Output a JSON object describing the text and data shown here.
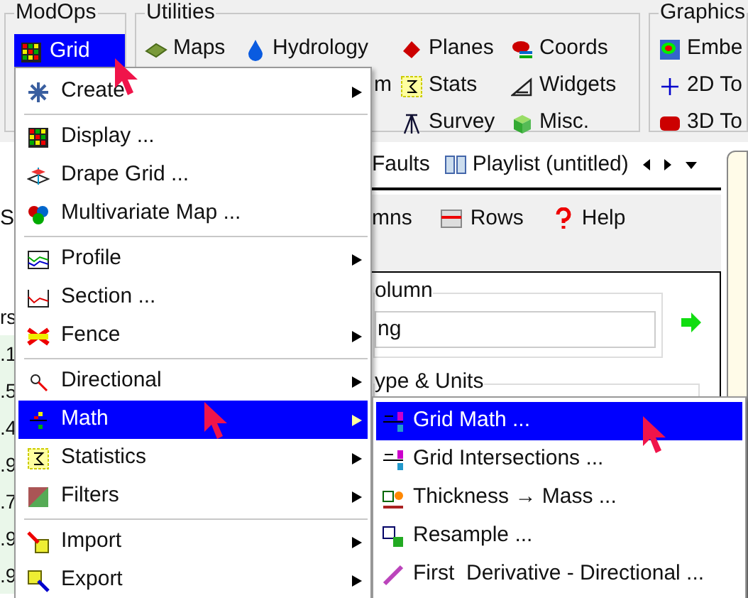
{
  "ribbon": {
    "groups": [
      {
        "title": "ModOps",
        "items": [
          {
            "label": "Grid",
            "selected": true
          }
        ]
      },
      {
        "title": "Utilities",
        "items": [
          {
            "label": "Maps"
          },
          {
            "label": "Hydrology"
          },
          {
            "label": "Planes"
          },
          {
            "label": "Coords"
          },
          {
            "label": "m"
          },
          {
            "label": "Stats"
          },
          {
            "label": "Widgets"
          },
          {
            "label": "Survey"
          },
          {
            "label": "Misc."
          }
        ]
      },
      {
        "title": "Graphics",
        "items": [
          {
            "label": "Embe"
          },
          {
            "label": "2D To"
          },
          {
            "label": "3D To"
          }
        ]
      }
    ]
  },
  "tabs": [
    {
      "label": "Faults"
    },
    {
      "label": "Playlist (untitled)"
    }
  ],
  "toolbar": [
    {
      "label": "S"
    },
    {
      "label": "mns"
    },
    {
      "label": "Rows"
    },
    {
      "label": "Help"
    }
  ],
  "side_values": [
    "rs",
    ".1",
    ".5",
    ".4",
    ".9",
    ".7",
    ".9",
    ".9"
  ],
  "panel": {
    "column_group": "olumn",
    "column_value": "ng",
    "type_group": "ype & Units"
  },
  "menu": [
    {
      "kind": "item",
      "label": "Create",
      "submenu": true,
      "selected": false
    },
    {
      "kind": "separator"
    },
    {
      "kind": "item",
      "label": "Display ...",
      "submenu": false,
      "selected": false
    },
    {
      "kind": "item",
      "label": "Drape Grid ...",
      "submenu": false,
      "selected": false
    },
    {
      "kind": "item",
      "label": "Multivariate Map ...",
      "submenu": false,
      "selected": false
    },
    {
      "kind": "separator"
    },
    {
      "kind": "item",
      "label": "Profile",
      "submenu": true,
      "selected": false
    },
    {
      "kind": "item",
      "label": "Section ...",
      "submenu": false,
      "selected": false
    },
    {
      "kind": "item",
      "label": "Fence",
      "submenu": true,
      "selected": false
    },
    {
      "kind": "separator"
    },
    {
      "kind": "item",
      "label": "Directional",
      "submenu": true,
      "selected": false
    },
    {
      "kind": "item",
      "label": "Math",
      "submenu": true,
      "selected": true
    },
    {
      "kind": "item",
      "label": "Statistics",
      "submenu": true,
      "selected": false
    },
    {
      "kind": "item",
      "label": "Filters",
      "submenu": true,
      "selected": false
    },
    {
      "kind": "separator"
    },
    {
      "kind": "item",
      "label": "Import",
      "submenu": true,
      "selected": false
    },
    {
      "kind": "item",
      "label": "Export",
      "submenu": true,
      "selected": false
    }
  ],
  "submenu": [
    {
      "label": "Grid Math ...",
      "selected": true
    },
    {
      "label": "Grid Intersections ...",
      "selected": false
    },
    {
      "label": "Thickness → Mass ...",
      "selected": false
    },
    {
      "label": "Resample ...",
      "selected": false
    },
    {
      "label": "First  Derivative - Directional ...",
      "selected": false
    }
  ]
}
